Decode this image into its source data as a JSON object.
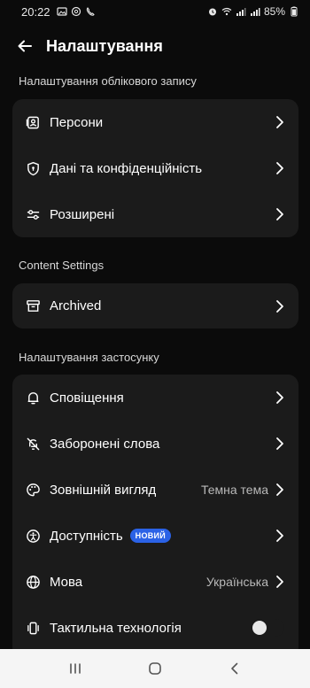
{
  "status_bar": {
    "time": "20:22",
    "battery": "85%",
    "left_icons": [
      "image-icon",
      "threads-icon",
      "viber-icon"
    ],
    "right_icons": [
      "alarm-icon",
      "wifi-icon",
      "signal-icon",
      "signal-icon-2",
      "battery-icon"
    ]
  },
  "header": {
    "title": "Налаштування",
    "back_icon": "arrow-left-icon"
  },
  "sections": {
    "account": {
      "title": "Налаштування облікового запису",
      "items": [
        {
          "label": "Персони",
          "icon": "persona-icon"
        },
        {
          "label": "Дані та конфіденційність",
          "icon": "shield-icon"
        },
        {
          "label": "Розширені",
          "icon": "sliders-icon"
        }
      ]
    },
    "content": {
      "title": "Content Settings",
      "items": [
        {
          "label": "Archived",
          "icon": "archive-icon"
        }
      ]
    },
    "app": {
      "title": "Налаштування застосунку",
      "items": [
        {
          "label": "Сповіщення",
          "icon": "bell-icon"
        },
        {
          "label": "Заборонені слова",
          "icon": "mute-icon"
        },
        {
          "label": "Зовнішній вигляд",
          "icon": "palette-icon",
          "value": "Темна тема"
        },
        {
          "label": "Доступність",
          "icon": "accessibility-icon",
          "badge": "НОВИЙ"
        },
        {
          "label": "Мова",
          "icon": "globe-icon",
          "value": "Українська"
        },
        {
          "label": "Тактильна технологія",
          "icon": "vibration-icon",
          "toggle": false
        }
      ]
    }
  },
  "colors": {
    "background": "#0b0b0b",
    "card": "#1b1b1b",
    "badge": "#2b62e6",
    "nav_bar": "#f5f5f5"
  },
  "nav_bar": {
    "buttons": [
      "recents-icon",
      "home-icon",
      "back-icon"
    ]
  }
}
